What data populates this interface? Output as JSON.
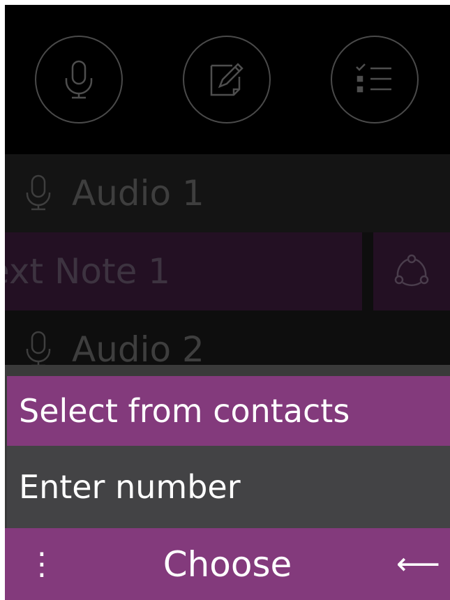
{
  "actions": {
    "icons": [
      "microphone-icon",
      "note-edit-icon",
      "checklist-icon"
    ]
  },
  "list": {
    "items": [
      {
        "label": "Audio 1",
        "icon": "microphone-icon"
      },
      {
        "label": "ext Note 1",
        "icon": "share-icon"
      },
      {
        "label": "Audio 2",
        "icon": "microphone-icon"
      }
    ]
  },
  "menu": {
    "options": [
      {
        "label": "Select from contacts",
        "selected": true
      },
      {
        "label": "Enter number",
        "selected": false
      }
    ]
  },
  "softkeys": {
    "left": "⋮",
    "center": "Choose",
    "right": "⟵"
  },
  "colors": {
    "accent": "#833a7c",
    "menu_bg": "#434345",
    "background": "#000000"
  }
}
